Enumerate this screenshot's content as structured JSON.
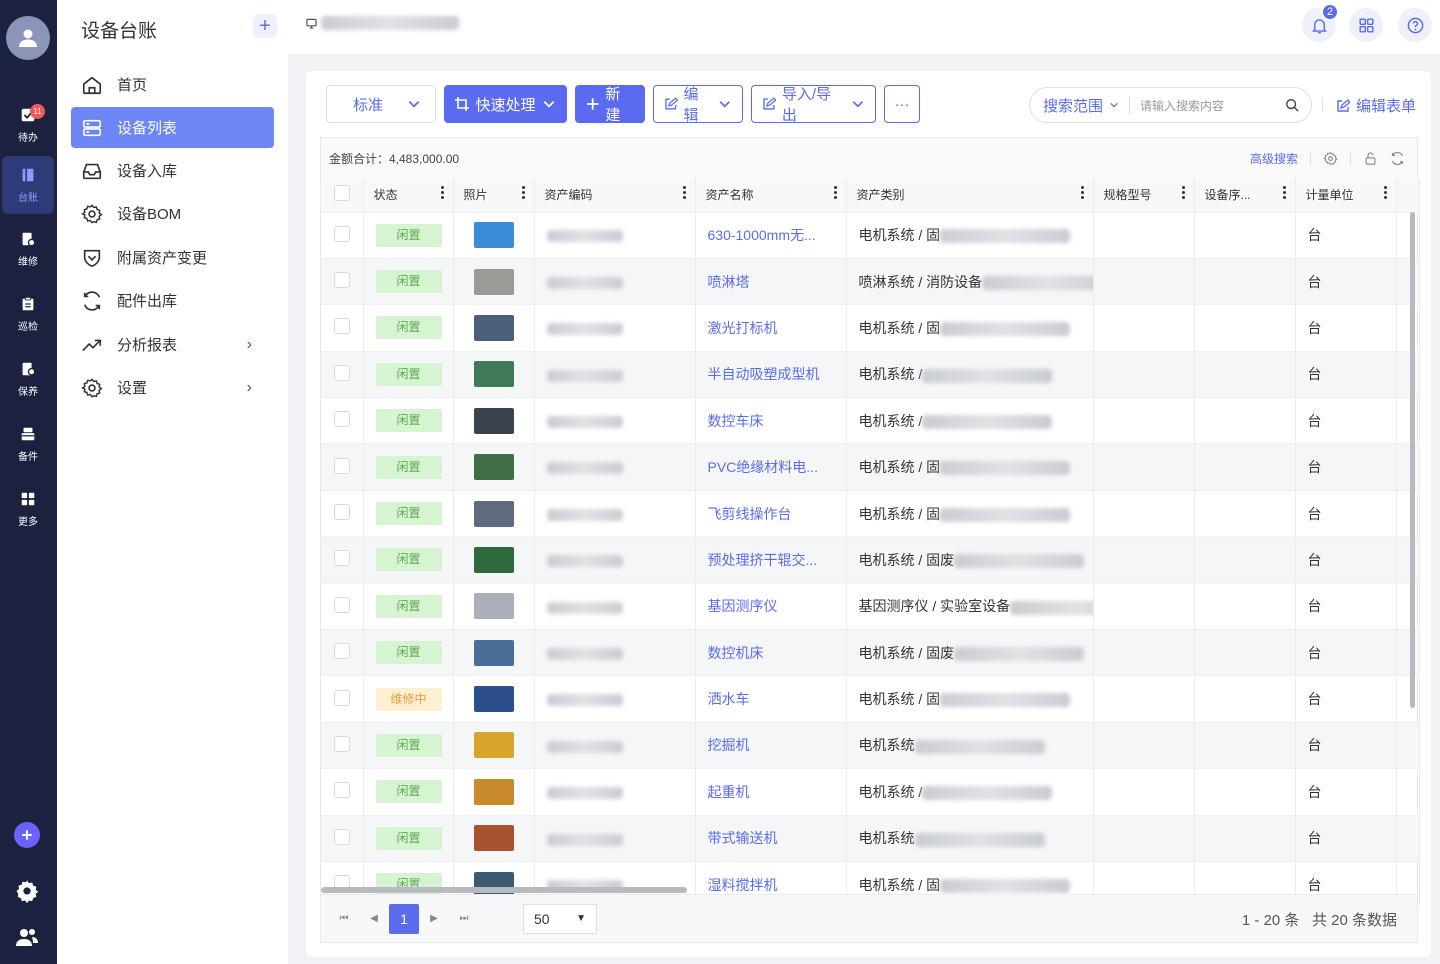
{
  "rail": {
    "badge_todo": "11",
    "items": [
      {
        "label": "待办",
        "icon": "todo-icon"
      },
      {
        "label": "台账",
        "icon": "ledger-icon"
      },
      {
        "label": "维修",
        "icon": "repair-icon"
      },
      {
        "label": "巡检",
        "icon": "inspection-icon"
      },
      {
        "label": "保养",
        "icon": "maintenance-icon"
      },
      {
        "label": "备件",
        "icon": "spare-parts-icon"
      },
      {
        "label": "更多",
        "icon": "more-apps-icon"
      }
    ]
  },
  "sidebar": {
    "title": "设备台账",
    "items": [
      {
        "label": "首页",
        "icon": "home-icon"
      },
      {
        "label": "设备列表",
        "icon": "list-icon"
      },
      {
        "label": "设备入库",
        "icon": "inbox-icon"
      },
      {
        "label": "设备BOM",
        "icon": "gear-icon"
      },
      {
        "label": "附属资产变更",
        "icon": "shield-icon"
      },
      {
        "label": "配件出库",
        "icon": "refresh-icon"
      },
      {
        "label": "分析报表",
        "icon": "trend-icon"
      },
      {
        "label": "设置",
        "icon": "settings-icon"
      }
    ]
  },
  "topbar": {
    "notification_count": "2"
  },
  "toolbar": {
    "view_label": "标准",
    "quick_label": "快速处理",
    "new_label": "新建",
    "edit_label": "编辑",
    "import_label": "导入/导出",
    "more_label": "···"
  },
  "search": {
    "scope_label": "搜索范围",
    "placeholder": "请输入搜索内容",
    "edit_form_label": "编辑表单"
  },
  "summary": {
    "text": "金额合计：4,483,000.00",
    "advanced_search": "高级搜索"
  },
  "table": {
    "columns": [
      "状态",
      "照片",
      "资产编码",
      "资产名称",
      "资产类别",
      "规格型号",
      "设备序...",
      "计量单位"
    ],
    "rows": [
      {
        "status": "闲置",
        "name": "630-1000mm无...",
        "category": "电机系统 / 固",
        "unit": "台",
        "photo_color": "#3a8bd8"
      },
      {
        "status": "闲置",
        "name": "喷淋塔",
        "category": "喷淋系统 / 消防设备",
        "unit": "台",
        "photo_color": "#9a9a96"
      },
      {
        "status": "闲置",
        "name": "激光打标机",
        "category": "电机系统 / 固",
        "unit": "台",
        "photo_color": "#4d5e7a"
      },
      {
        "status": "闲置",
        "name": "半自动吸塑成型机",
        "category": "电机系统 /",
        "unit": "台",
        "photo_color": "#3f7a58"
      },
      {
        "status": "闲置",
        "name": "数控车床",
        "category": "电机系统 /",
        "unit": "台",
        "photo_color": "#3c4350"
      },
      {
        "status": "闲置",
        "name": "PVC绝缘材料电...",
        "category": "电机系统 / 固",
        "unit": "台",
        "photo_color": "#3f6e46"
      },
      {
        "status": "闲置",
        "name": "飞剪线操作台",
        "category": "电机系统 / 固",
        "unit": "台",
        "photo_color": "#5d6a80"
      },
      {
        "status": "闲置",
        "name": "预处理挤干辊交...",
        "category": "电机系统 / 固废",
        "unit": "台",
        "photo_color": "#2f6a3d"
      },
      {
        "status": "闲置",
        "name": "基因测序仪",
        "category": "基因测序仪 / 实验室设备",
        "unit": "台",
        "photo_color": "#a9b0b9"
      },
      {
        "status": "闲置",
        "name": "数控机床",
        "category": "电机系统 / 固废",
        "unit": "台",
        "photo_color": "#4a6e9a"
      },
      {
        "status": "维修中",
        "name": "洒水车",
        "category": "电机系统 / 固",
        "unit": "台",
        "photo_color": "#2b4f8a"
      },
      {
        "status": "闲置",
        "name": "挖掘机",
        "category": "电机系统",
        "unit": "台",
        "photo_color": "#d9a42b"
      },
      {
        "status": "闲置",
        "name": "起重机",
        "category": "电机系统 /",
        "unit": "台",
        "photo_color": "#c98a2c"
      },
      {
        "status": "闲置",
        "name": "带式输送机",
        "category": "电机系统",
        "unit": "台",
        "photo_color": "#a8522f"
      },
      {
        "status": "闲置",
        "name": "湿料搅拌机",
        "category": "电机系统 / 固",
        "unit": "台",
        "photo_color": "#3d5a74"
      }
    ]
  },
  "pager": {
    "current": "1",
    "page_size": "50",
    "range": "1 - 20 条",
    "total": "共 20 条数据"
  },
  "colors": {
    "accent": "#5a6bf0",
    "rail": "#1c2140",
    "idle": "#5ca94f",
    "repair": "#e0a23a"
  }
}
